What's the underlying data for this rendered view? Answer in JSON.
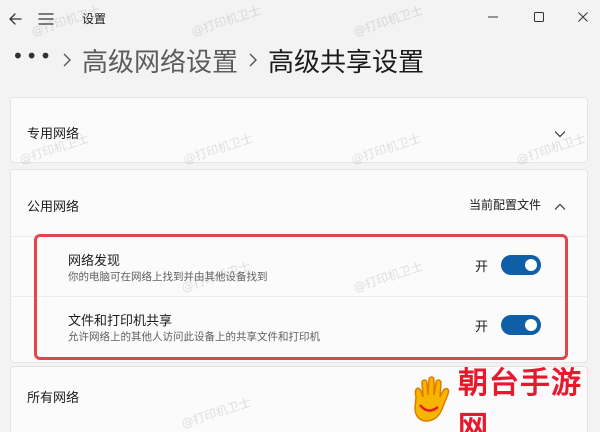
{
  "window": {
    "title": "设置"
  },
  "breadcrumb": {
    "more": "•••",
    "parent": "高级网络设置",
    "current": "高级共享设置"
  },
  "private_network": {
    "label": "专用网络"
  },
  "public_network": {
    "label": "公用网络",
    "profile_text": "当前配置文件",
    "discovery": {
      "title": "网络发现",
      "description": "你的电脑可在网络上找到并由其他设备找到",
      "state": "开",
      "on": true
    },
    "sharing": {
      "title": "文件和打印机共享",
      "description": "允许网络上的其他人访问此设备上的共享文件和打印机",
      "state": "开",
      "on": true
    }
  },
  "all_networks": {
    "label": "所有网络"
  },
  "watermark": "@打印机卫士",
  "brand": {
    "name": "朝台手游网"
  },
  "colors": {
    "accent": "#0f5ea8",
    "highlight": "#e0474c",
    "brand": "#e8192c"
  },
  "icons": {
    "back": "back-arrow-icon",
    "menu": "hamburger-icon",
    "minimize": "minimize-icon",
    "maximize": "maximize-icon",
    "close": "close-icon",
    "chevron_right": "chevron-right-icon",
    "chevron_down": "chevron-down-icon",
    "chevron_up": "chevron-up-icon",
    "brand_hand": "hand-logo-icon"
  }
}
